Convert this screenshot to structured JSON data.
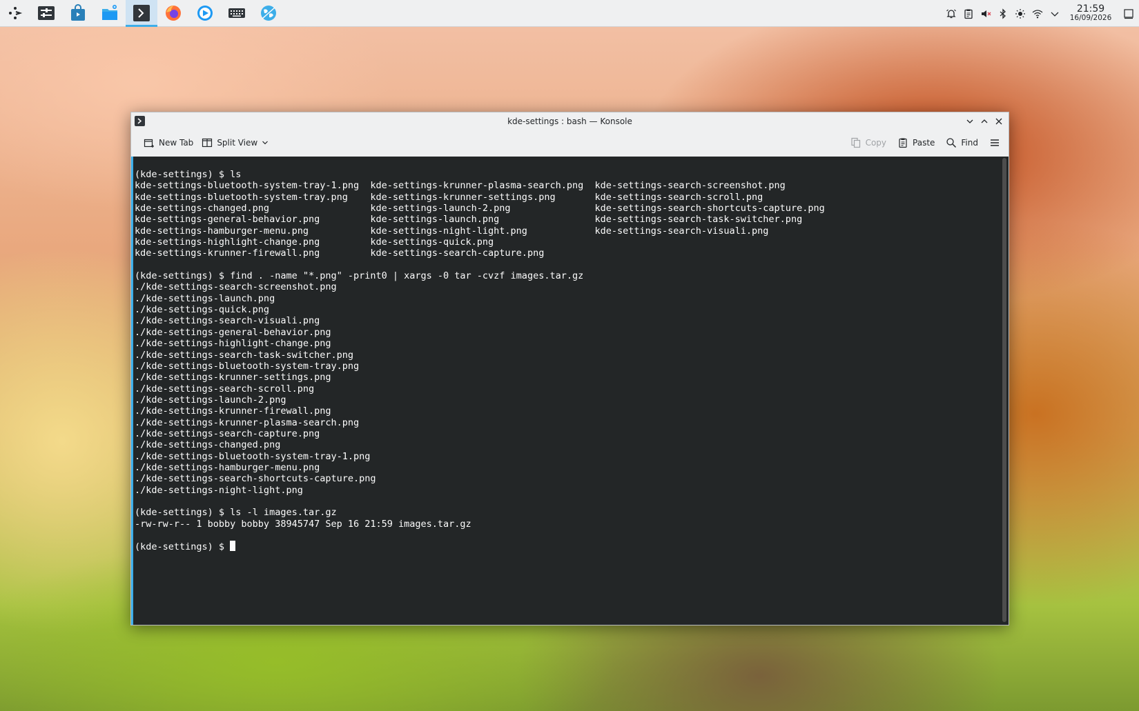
{
  "panel": {
    "launcher_icon": "kde-application-launcher-icon",
    "tasks": [
      {
        "name": "system-settings-icon",
        "active": false
      },
      {
        "name": "discover-store-icon",
        "active": false
      },
      {
        "name": "dolphin-file-manager-icon",
        "active": false
      },
      {
        "name": "konsole-terminal-icon",
        "active": true
      },
      {
        "name": "firefox-icon",
        "active": false
      },
      {
        "name": "media-player-icon",
        "active": false
      },
      {
        "name": "keyboard-settings-icon",
        "active": false
      },
      {
        "name": "web-browser-globe-icon",
        "active": false
      }
    ],
    "tray": [
      "notifications-icon",
      "clipboard-icon",
      "volume-muted-icon",
      "bluetooth-icon",
      "brightness-icon",
      "wifi-icon",
      "expand-tray-chevron-icon"
    ],
    "clock_time": "21:59",
    "clock_date": "16/09/2026"
  },
  "window": {
    "title": "kde-settings : bash — Konsole",
    "toolbar": {
      "new_tab": "New Tab",
      "split_view": "Split View",
      "copy": "Copy",
      "paste": "Paste",
      "find": "Find"
    },
    "terminal_lines": [
      "(kde-settings) $ ls",
      "kde-settings-bluetooth-system-tray-1.png  kde-settings-krunner-plasma-search.png  kde-settings-search-screenshot.png",
      "kde-settings-bluetooth-system-tray.png    kde-settings-krunner-settings.png       kde-settings-search-scroll.png",
      "kde-settings-changed.png                  kde-settings-launch-2.png               kde-settings-search-shortcuts-capture.png",
      "kde-settings-general-behavior.png         kde-settings-launch.png                 kde-settings-search-task-switcher.png",
      "kde-settings-hamburger-menu.png           kde-settings-night-light.png            kde-settings-search-visuali.png",
      "kde-settings-highlight-change.png         kde-settings-quick.png",
      "kde-settings-krunner-firewall.png         kde-settings-search-capture.png",
      "",
      "(kde-settings) $ find . -name \"*.png\" -print0 | xargs -0 tar -cvzf images.tar.gz",
      "./kde-settings-search-screenshot.png",
      "./kde-settings-launch.png",
      "./kde-settings-quick.png",
      "./kde-settings-search-visuali.png",
      "./kde-settings-general-behavior.png",
      "./kde-settings-highlight-change.png",
      "./kde-settings-search-task-switcher.png",
      "./kde-settings-bluetooth-system-tray.png",
      "./kde-settings-krunner-settings.png",
      "./kde-settings-search-scroll.png",
      "./kde-settings-launch-2.png",
      "./kde-settings-krunner-firewall.png",
      "./kde-settings-krunner-plasma-search.png",
      "./kde-settings-search-capture.png",
      "./kde-settings-changed.png",
      "./kde-settings-bluetooth-system-tray-1.png",
      "./kde-settings-hamburger-menu.png",
      "./kde-settings-search-shortcuts-capture.png",
      "./kde-settings-night-light.png",
      "",
      "(kde-settings) $ ls -l images.tar.gz",
      "-rw-rw-r-- 1 bobby bobby 38945747 Sep 16 21:59 images.tar.gz",
      ""
    ],
    "prompt": "(kde-settings) $ "
  }
}
